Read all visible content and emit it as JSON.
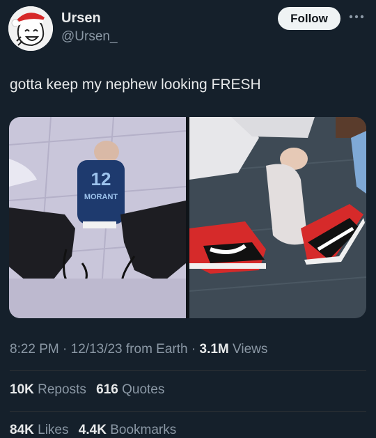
{
  "user": {
    "name": "Ursen",
    "handle": "@Ursen_",
    "follow_label": "Follow"
  },
  "tweet": {
    "text": "gotta keep my nephew looking FRESH",
    "jersey_number": "12",
    "jersey_name": "MORANT"
  },
  "meta": {
    "time": "8:22 PM",
    "sep1": "·",
    "date": "12/13/23",
    "source": "from Earth",
    "sep2": "·",
    "views_count": "3.1M",
    "views_label": "Views"
  },
  "stats": {
    "reposts_count": "10K",
    "reposts_label": "Reposts",
    "quotes_count": "616",
    "quotes_label": "Quotes",
    "likes_count": "84K",
    "likes_label": "Likes",
    "bookmarks_count": "4.4K",
    "bookmarks_label": "Bookmarks"
  },
  "colors": {
    "background": "#15202b",
    "text": "#e7e9ea",
    "secondary": "#8b98a5",
    "follow_bg": "#eff3f4"
  }
}
